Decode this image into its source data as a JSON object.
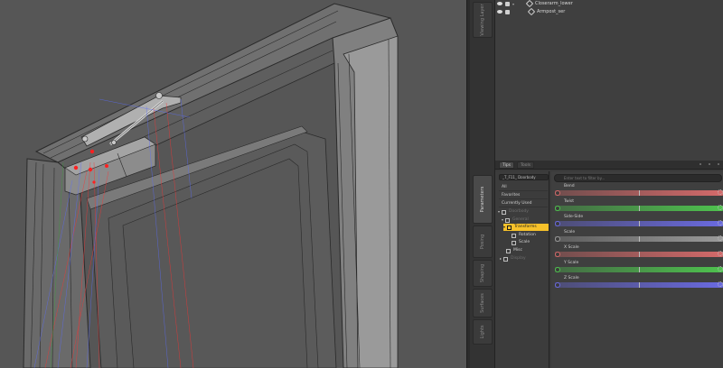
{
  "viewport": {
    "colors": {
      "background": "#565656",
      "frame": "#6c6c6c",
      "edge": "#2a2a2a",
      "gizmo_red": "#ff3030",
      "gizmo_blue": "#5a6cff"
    }
  },
  "left_tabs": [
    "Viewing Layer",
    "Parameters",
    "Posing",
    "Shaping",
    "Surfaces",
    "Lights"
  ],
  "scene": {
    "rows": [
      {
        "label": "Closerarm_lower"
      },
      {
        "label": "Armpost_ser"
      }
    ]
  },
  "pane_header": {
    "tabs": [
      "Tips",
      "Tools"
    ]
  },
  "categories": {
    "preset": "_T_F11_ Doorbody",
    "items": [
      "All",
      "Favorites",
      "Currently Used"
    ],
    "tree": [
      {
        "label": "Doorbody",
        "dim": true
      },
      {
        "label": "General",
        "dim": true
      },
      {
        "label": "Transforms",
        "selected": true
      },
      {
        "label": "Rotation"
      },
      {
        "label": "Scale"
      },
      {
        "label": "Misc"
      },
      {
        "label": "Display",
        "dim": true
      }
    ]
  },
  "parameters": {
    "search_placeholder": "Enter text to filter by...",
    "rows": [
      {
        "name": "Bend",
        "color": "#d46a6a",
        "value": 0.5
      },
      {
        "name": "Twist",
        "color": "#4ec24e",
        "value": 0.5
      },
      {
        "name": "Side-Side",
        "color": "#6a6ae0",
        "value": 0.5
      },
      {
        "name": "Scale",
        "color": "#9a9a9a",
        "value": 0.5
      },
      {
        "name": "X Scale",
        "color": "#d46a6a",
        "value": 0.5
      },
      {
        "name": "Y Scale",
        "color": "#4ec24e",
        "value": 0.5
      },
      {
        "name": "Z Scale",
        "color": "#6a6ae0",
        "value": 0.5
      }
    ]
  }
}
